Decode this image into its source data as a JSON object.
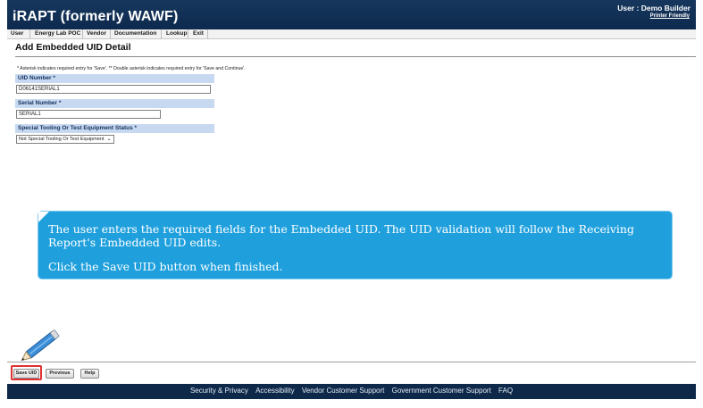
{
  "header": {
    "app_title": "iRAPT (formerly WAWF)",
    "user_label": "User : Demo Builder",
    "printer_friendly": "Printer Friendly"
  },
  "menu": [
    "User",
    "Energy Lab POC",
    "Vendor",
    "Documentation",
    "Lookup",
    "Exit"
  ],
  "page": {
    "title": "Add Embedded UID Detail",
    "instructions": "* Asterisk indicates required entry for 'Save'.  ** Double asterisk indicates required entry for 'Save and Continue'."
  },
  "form": {
    "uid_label": "UID Number *",
    "uid_value": "D06141SERIAL1",
    "serial_label": "Serial Number *",
    "serial_value": "SERIAL1",
    "stes_label": "Special Tooling Or Test Equipment Status *",
    "stes_value": "Not Special Tooling Or Test Equipment"
  },
  "callout": {
    "line1": "The user enters the required fields for the Embedded UID.  The UID validation will follow the Receiving",
    "line2": "Report's Embedded UID edits.",
    "line3": "Click the Save UID button when finished."
  },
  "buttons": {
    "save_uid": "Save UID",
    "previous": "Previous",
    "help": "Help"
  },
  "footer": {
    "links": [
      "Security & Privacy",
      "Accessibility",
      "Vendor Customer Support",
      "Government Customer Support",
      "FAQ"
    ]
  },
  "colors": {
    "header_bg": "#17375e",
    "label_bg": "#c7d9f1",
    "callout_bg": "#1fa0dd",
    "highlight": "#e03030"
  },
  "icons": [
    "pencil-icon",
    "chevron-down-icon"
  ]
}
